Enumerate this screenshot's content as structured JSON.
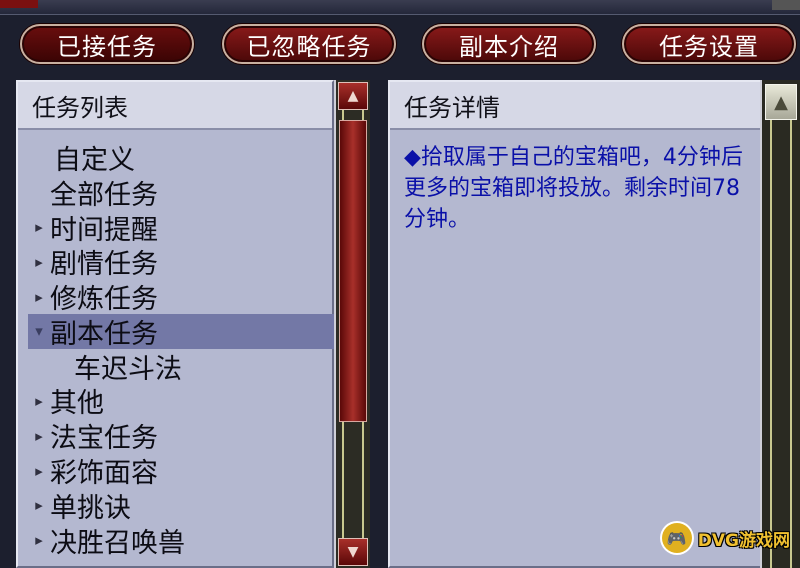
{
  "tabs": [
    {
      "label": "已接任务",
      "active": true
    },
    {
      "label": "已忽略任务",
      "active": false
    },
    {
      "label": "副本介绍",
      "active": false
    },
    {
      "label": "任务设置",
      "active": false
    }
  ],
  "left_panel": {
    "title": "任务列表",
    "items": [
      {
        "label": "自定义",
        "arrow": "",
        "level": 0,
        "selected": false
      },
      {
        "label": "全部任务",
        "arrow": "",
        "level": 0,
        "selected": false
      },
      {
        "label": "时间提醒",
        "arrow": "▸",
        "level": 0,
        "selected": false
      },
      {
        "label": "剧情任务",
        "arrow": "▸",
        "level": 0,
        "selected": false
      },
      {
        "label": "修炼任务",
        "arrow": "▸",
        "level": 0,
        "selected": false
      },
      {
        "label": "副本任务",
        "arrow": "▾",
        "level": 0,
        "selected": true
      },
      {
        "label": "车迟斗法",
        "arrow": "",
        "level": 1,
        "selected": false
      },
      {
        "label": "其他",
        "arrow": "▸",
        "level": 0,
        "selected": false
      },
      {
        "label": "法宝任务",
        "arrow": "▸",
        "level": 0,
        "selected": false
      },
      {
        "label": "彩饰面容",
        "arrow": "▸",
        "level": 0,
        "selected": false
      },
      {
        "label": "单挑诀",
        "arrow": "▸",
        "level": 0,
        "selected": false
      },
      {
        "label": "决胜召唤兽",
        "arrow": "▸",
        "level": 0,
        "selected": false
      }
    ]
  },
  "right_panel": {
    "title": "任务详情",
    "description": "◆拾取属于自己的宝箱吧，4分钟后更多的宝箱即将投放。剩余时间78分钟。"
  },
  "watermark": {
    "text": "DVG游戏网",
    "icon": "gamepad-icon"
  },
  "colors": {
    "tab_red": "#8a1a1a",
    "panel_bg": "#b4b8d0",
    "selected_row": "#7378a6",
    "detail_text": "#0a10a8"
  }
}
